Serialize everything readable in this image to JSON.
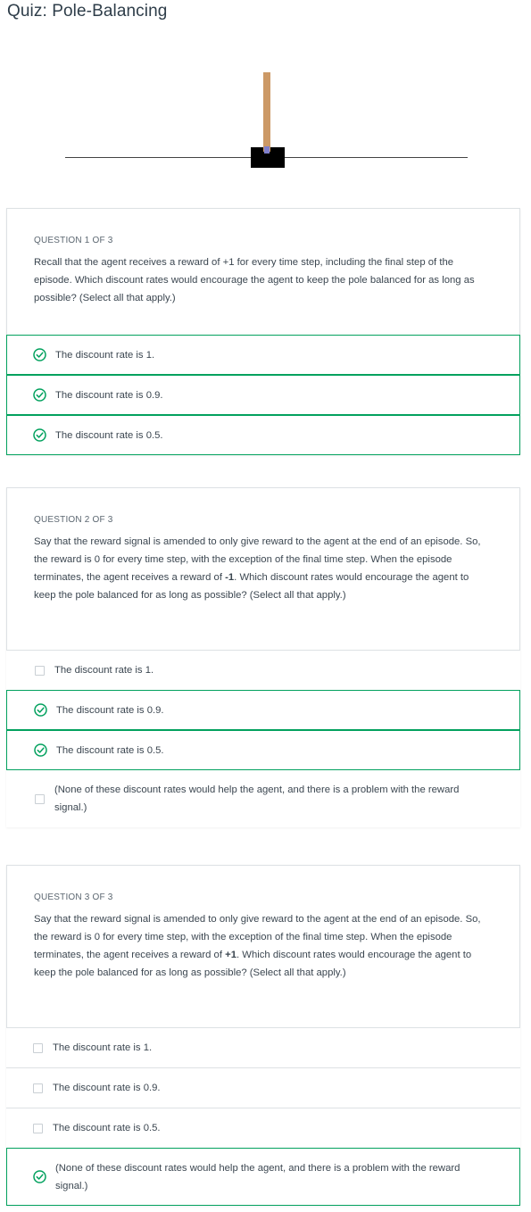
{
  "page": {
    "title": "Quiz: Pole-Balancing"
  },
  "colors": {
    "selected_border": "#02a15e",
    "check": "#02a15e",
    "card_border": "#dde1e4"
  },
  "questions": [
    {
      "label": "QUESTION 1 OF 3",
      "text": "Recall that the agent receives a reward of +1 for every time step, including the final step of the episode. Which discount rates would encourage the agent to keep the pole balanced for as long as possible? (Select all that apply.)",
      "options": [
        {
          "label": "The discount rate is 1.",
          "selected": true
        },
        {
          "label": "The discount rate is 0.9.",
          "selected": true
        },
        {
          "label": "The discount rate is 0.5.",
          "selected": true
        }
      ]
    },
    {
      "label": "QUESTION 2 OF 3",
      "text_before": "Say that the reward signal is amended to only give reward to the agent at the end of an episode. So, the reward is 0 for every time step, with the exception of the final time step. When the episode terminates, the agent receives a reward of ",
      "text_reward": "-1",
      "text_after": ". Which discount rates would encourage the agent to keep the pole balanced for as long as possible? (Select all that apply.)",
      "options": [
        {
          "label": "The discount rate is 1.",
          "selected": false
        },
        {
          "label": "The discount rate is 0.9.",
          "selected": true
        },
        {
          "label": "The discount rate is 0.5.",
          "selected": true
        },
        {
          "label": "(None of these discount rates would help the agent, and there is a problem with the reward signal.)",
          "selected": false
        }
      ]
    },
    {
      "label": "QUESTION 3 OF 3",
      "text_before": "Say that the reward signal is amended to only give reward to the agent at the end of an episode. So, the reward is 0 for every time step, with the exception of the final time step. When the episode terminates, the agent receives a reward of ",
      "text_reward": "+1",
      "text_after": ". Which discount rates would encourage the agent to keep the pole balanced for as long as possible? (Select all that apply.)",
      "options": [
        {
          "label": "The discount rate is 1.",
          "selected": false
        },
        {
          "label": "The discount rate is 0.9.",
          "selected": false
        },
        {
          "label": "The discount rate is 0.5.",
          "selected": false
        },
        {
          "label": "(None of these discount rates would help the agent, and there is a problem with the reward signal.)",
          "selected": true
        }
      ]
    }
  ]
}
